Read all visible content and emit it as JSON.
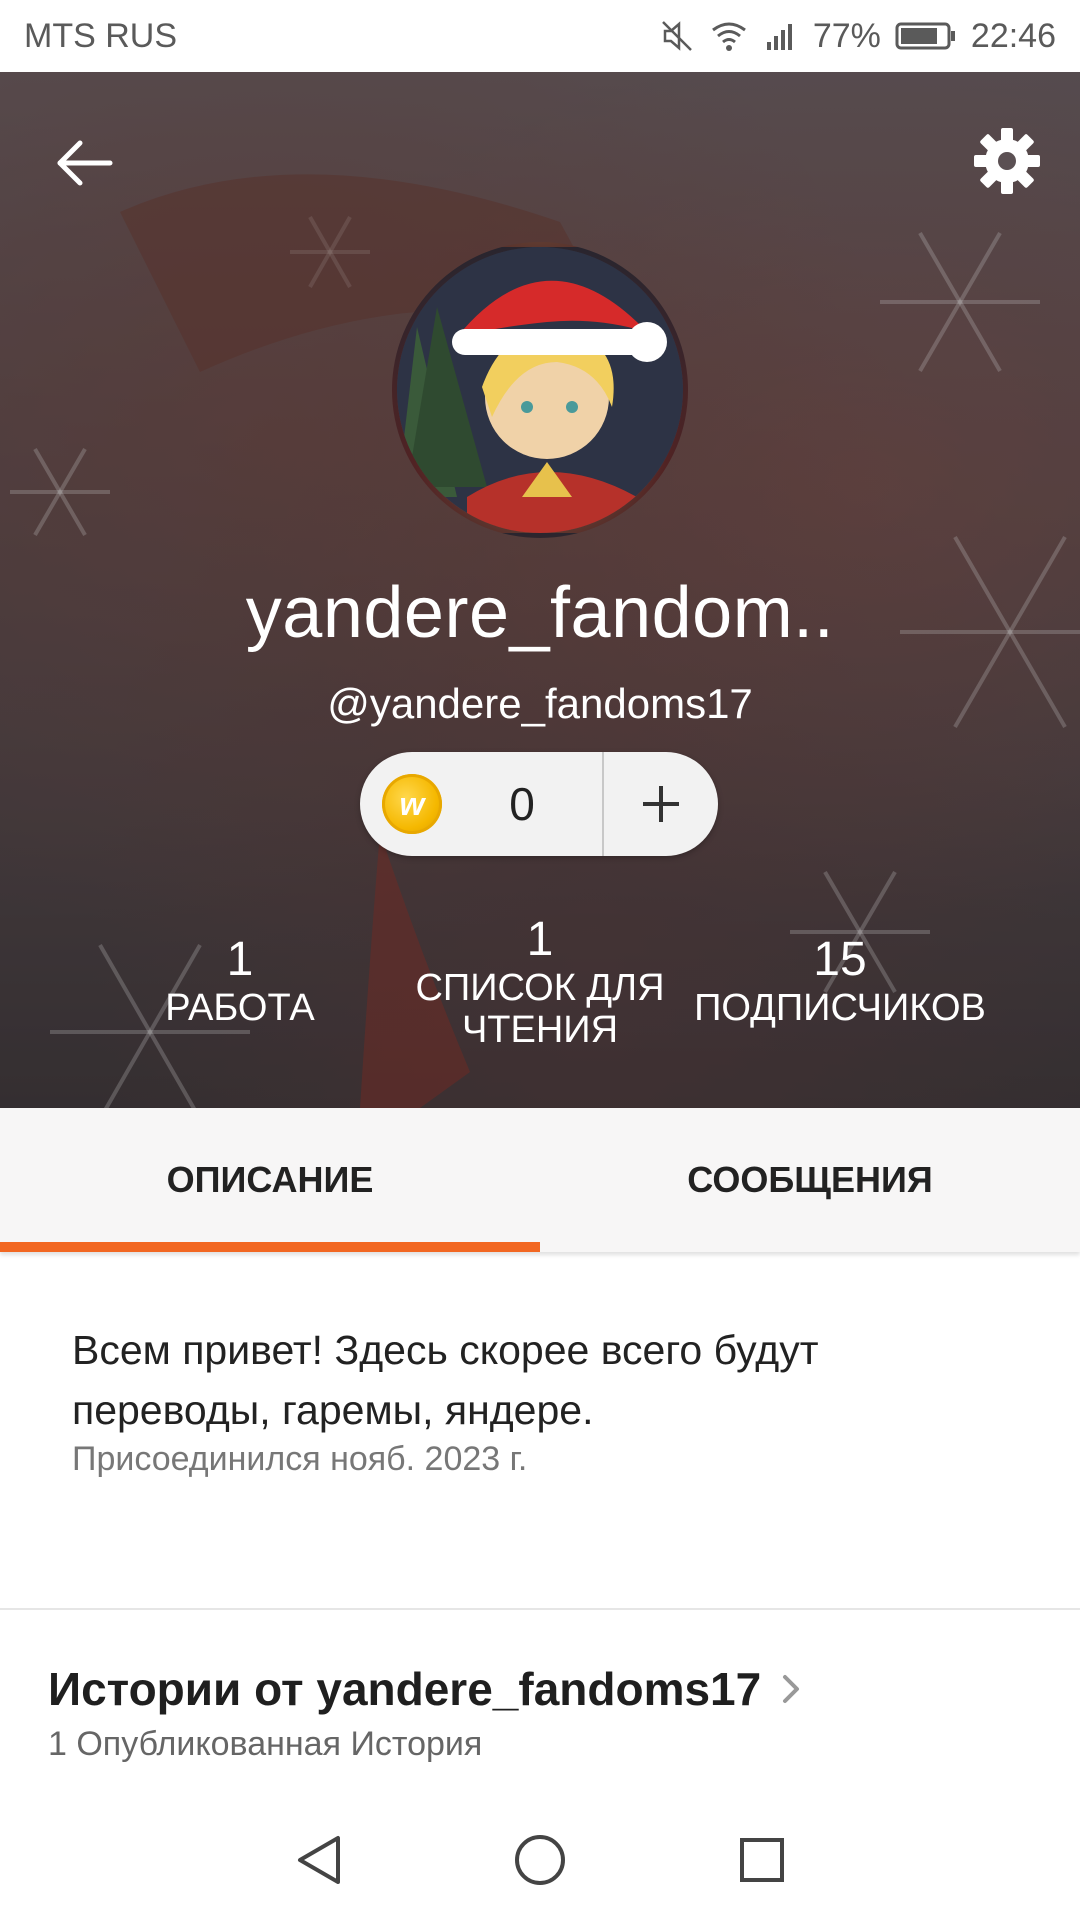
{
  "status_bar": {
    "carrier": "MTS RUS",
    "battery": "77%",
    "time": "22:46"
  },
  "profile": {
    "display_name": "yandere_fandom..",
    "handle": "@yandere_fandoms17",
    "coins": "0",
    "stats": {
      "works_count": "1",
      "works_label": "РАБОТА",
      "reading_count": "1",
      "reading_label_line1": "СПИСОК ДЛЯ",
      "reading_label_line2": "ЧТЕНИЯ",
      "followers_count": "15",
      "followers_label": "ПОДПИСЧИКОВ"
    }
  },
  "tabs": [
    {
      "label": "ОПИСАНИЕ",
      "active": true
    },
    {
      "label": "СООБЩЕНИЯ",
      "active": false
    }
  ],
  "about": {
    "description": "Всем привет! Здесь скорее всего будут переводы, гаремы, яндере.",
    "joined": "Присоединился нояб. 2023 г."
  },
  "stories": {
    "title": "Истории от yandere_fandoms17",
    "count": "1 Опубликованная История"
  },
  "colors": {
    "accent": "#f26722",
    "coin": "#f5b800"
  },
  "icons": {
    "back": "arrow-left-icon",
    "settings": "gear-icon",
    "coin": "wattpad-coin-icon",
    "add": "plus-icon",
    "chevron": "chevron-right-icon",
    "nav_back": "triangle-back-icon",
    "nav_home": "circle-home-icon",
    "nav_recents": "square-recents-icon"
  }
}
